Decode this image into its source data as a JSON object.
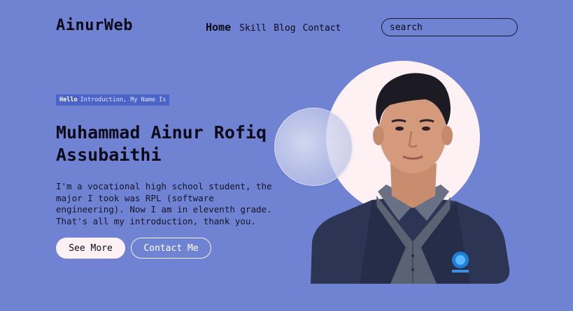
{
  "header": {
    "logo": "AinurWeb",
    "nav": [
      {
        "label": "Home",
        "active": true
      },
      {
        "label": "Skill",
        "active": false
      },
      {
        "label": "Blog",
        "active": false
      },
      {
        "label": "Contact",
        "active": false
      }
    ],
    "search": {
      "placeholder": "search",
      "value": ""
    }
  },
  "hero": {
    "badge_strong": "Hello",
    "badge_text": "Introduction, My Name Is",
    "title": "Muhammad Ainur Rofiq Assubaithi",
    "description": "I'm a vocational high school student, the major I took was RPL (software engineering). Now I am in eleventh grade. That's all my introduction, thank you.",
    "buttons": {
      "see_more": "See More",
      "contact_me": "Contact Me"
    }
  },
  "colors": {
    "background": "#7083d3",
    "badge": "#4b64c8",
    "circle": "#fdf1f3",
    "text": "#0b0b1a"
  }
}
